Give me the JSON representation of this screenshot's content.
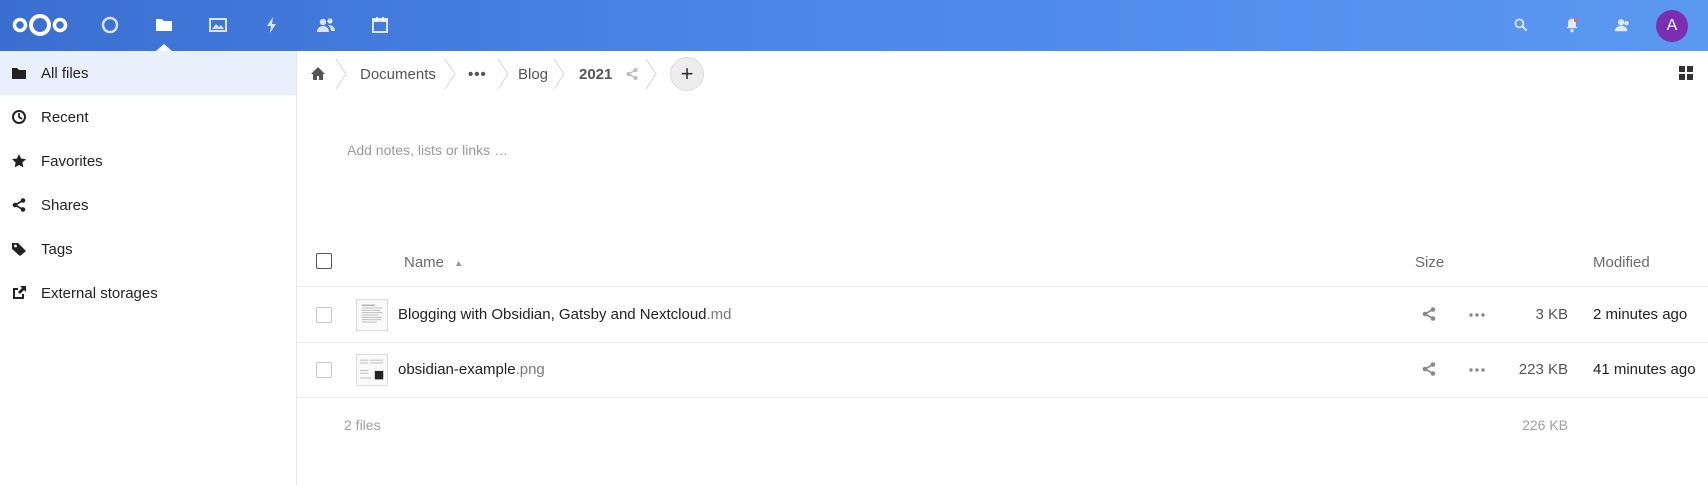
{
  "header": {
    "apps": [
      {
        "name": "dashboard-icon"
      },
      {
        "name": "files-icon"
      },
      {
        "name": "photos-icon"
      },
      {
        "name": "activity-icon"
      },
      {
        "name": "contacts-icon"
      },
      {
        "name": "calendar-icon"
      }
    ],
    "right_icons": [
      "search-icon",
      "notifications-icon",
      "contacts-menu-icon"
    ],
    "avatar_letter": "A",
    "accent": "#4c86e6",
    "avatar_color": "#7a2fb3"
  },
  "sidebar": {
    "items": [
      {
        "label": "All files",
        "icon": "folder-icon"
      },
      {
        "label": "Recent",
        "icon": "clock-icon"
      },
      {
        "label": "Favorites",
        "icon": "star-icon"
      },
      {
        "label": "Shares",
        "icon": "share-icon"
      },
      {
        "label": "Tags",
        "icon": "tag-icon"
      },
      {
        "label": "External storages",
        "icon": "external-link-icon"
      }
    ]
  },
  "breadcrumb": {
    "home_icon": "home-icon",
    "items": [
      "Documents",
      "•••",
      "Blog",
      "2021"
    ],
    "share_icon": "share-icon",
    "add_label": "+"
  },
  "notes": {
    "placeholder": "Add notes, lists or links …"
  },
  "table": {
    "headers": {
      "name": "Name",
      "size": "Size",
      "modified": "Modified"
    },
    "sort_indicator": "▲",
    "files": [
      {
        "basename": "Blogging with Obsidian, Gatsby and Nextcloud",
        "ext": ".md",
        "size": "3 KB",
        "modified": "2 minutes ago"
      },
      {
        "basename": "obsidian-example",
        "ext": ".png",
        "size": "223 KB",
        "modified": "41 minutes ago"
      }
    ],
    "summary": {
      "count": "2 files",
      "size": "226 KB"
    }
  }
}
